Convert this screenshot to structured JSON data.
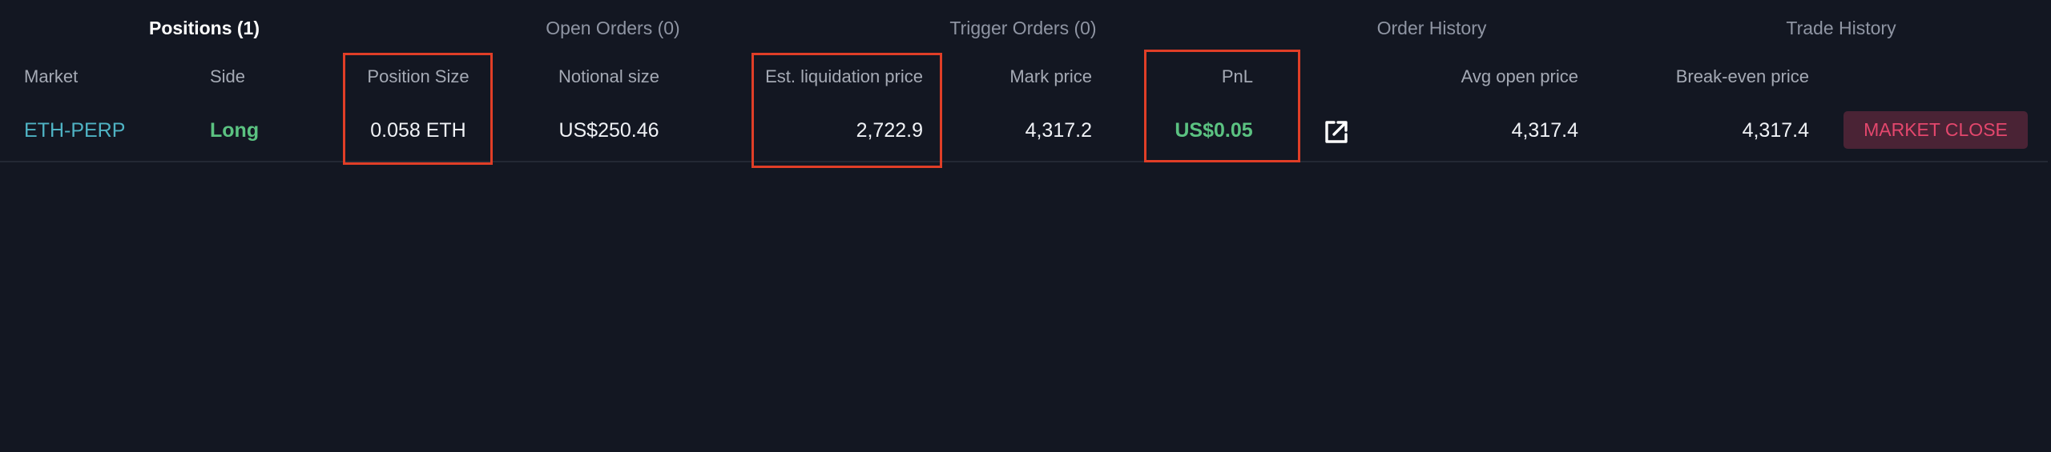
{
  "tabs": [
    {
      "label": "Positions (1)",
      "active": true
    },
    {
      "label": "Open Orders (0)",
      "active": false
    },
    {
      "label": "Trigger Orders (0)",
      "active": false
    },
    {
      "label": "Order History",
      "active": false
    },
    {
      "label": "Trade History",
      "active": false
    }
  ],
  "table": {
    "headers": {
      "market": "Market",
      "side": "Side",
      "position_size": "Position Size",
      "notional_size": "Notional size",
      "est_liquidation_price": "Est. liquidation price",
      "mark_price": "Mark price",
      "pnl": "PnL",
      "avg_open_price": "Avg open price",
      "break_even_price": "Break-even price"
    },
    "rows": [
      {
        "market": "ETH-PERP",
        "side": "Long",
        "position_size": "0.058 ETH",
        "notional_size": "US$250.46",
        "est_liquidation_price": "2,722.9",
        "mark_price": "4,317.2",
        "pnl": "US$0.05",
        "share_icon": "external-link-icon",
        "avg_open_price": "4,317.4",
        "break_even_price": "4,317.4",
        "action_label": "MARKET CLOSE"
      }
    ]
  },
  "colors": {
    "background": "#131722",
    "market_link": "#4fb3c4",
    "positive": "#5bc281",
    "close_button_bg": "#4a2335",
    "close_button_text": "#e4476d",
    "highlight_box": "#e03e27"
  }
}
